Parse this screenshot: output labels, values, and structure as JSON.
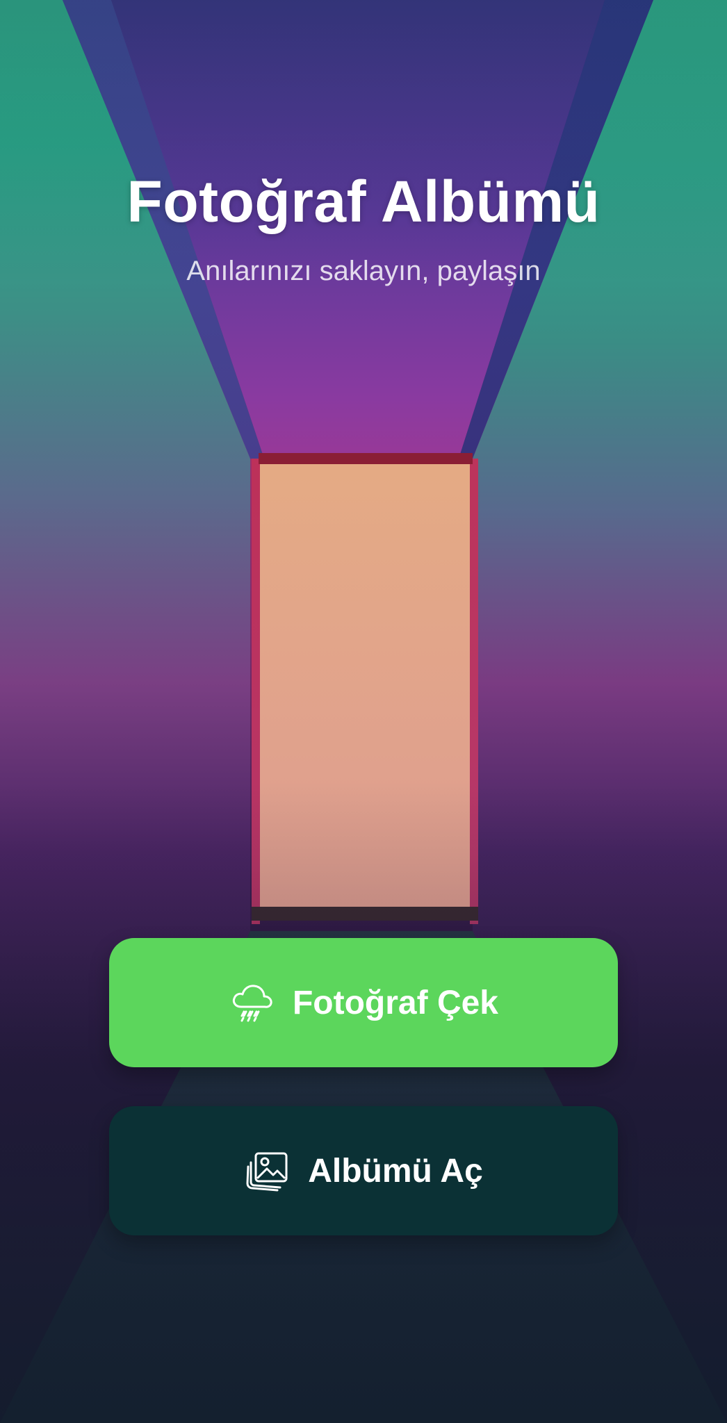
{
  "app": {
    "title": "Fotoğraf Albümü",
    "subtitle": "Anılarınızı saklayın, paylaşın"
  },
  "actions": {
    "take_photo": {
      "label": "Fotoğraf Çek",
      "icon": "cloud-rain-icon",
      "color": "#5cd65c"
    },
    "open_album": {
      "label": "Albümü Aç",
      "icon": "photos-icon",
      "color": "#0b3135"
    }
  },
  "background": {
    "description_colors": [
      "#2fb28e",
      "#7a3f83",
      "#e03a6a",
      "#e6b07e",
      "#1e3040"
    ]
  }
}
